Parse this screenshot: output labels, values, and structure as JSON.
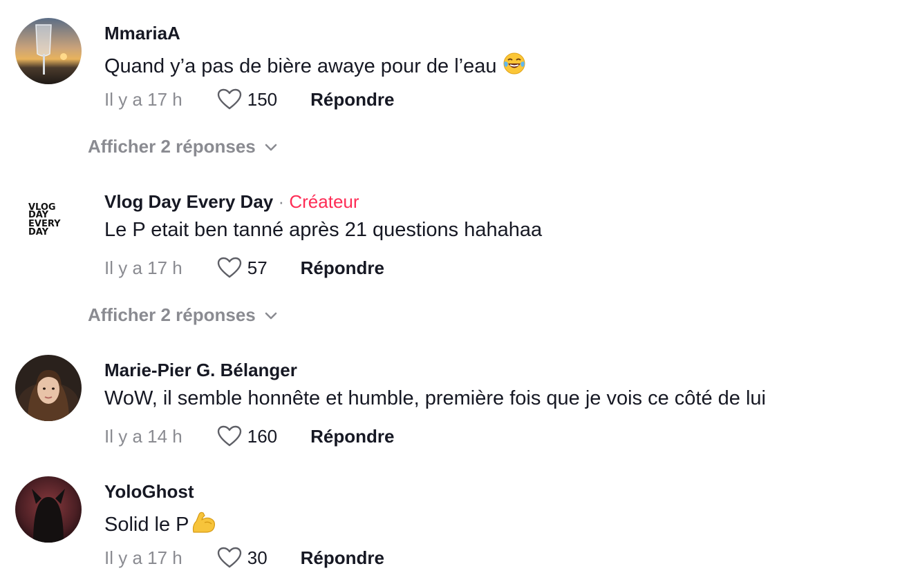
{
  "comments": [
    {
      "username": "MmariaA",
      "text": "Quand y’a pas de bière awaye pour de l’eau",
      "emoji": "laughing-crying-emoji",
      "time": "Il y a 17 h",
      "likes": "150",
      "reply_label": "Répondre",
      "view_replies": "Afficher 2 réponses"
    },
    {
      "username": "Vlog Day Every Day",
      "creator_sep": "·",
      "creator_badge": "Créateur",
      "avatar_text": [
        "VLOG",
        "DAY",
        "EVERY",
        "DAY"
      ],
      "text": "Le P etait ben tanné après 21 questions hahahaa",
      "time": "Il y a 17 h",
      "likes": "57",
      "reply_label": "Répondre",
      "view_replies": "Afficher 2 réponses"
    },
    {
      "username": "Marie-Pier G. Bélanger",
      "text": "WoW, il semble honnête et humble, première fois que je vois ce côté de lui",
      "time": "Il y a 14 h",
      "likes": "160",
      "reply_label": "Répondre"
    },
    {
      "username": "YoloGhost",
      "text": "Solid le P",
      "emoji": "flexed-biceps-emoji",
      "time": "Il y a 17 h",
      "likes": "30",
      "reply_label": "Répondre"
    }
  ],
  "icons": {
    "like": "heart-outline-icon",
    "expand": "chevron-down-icon"
  },
  "colors": {
    "text": "#161823",
    "muted": "#8a8b91",
    "creator": "#fe2c55"
  }
}
